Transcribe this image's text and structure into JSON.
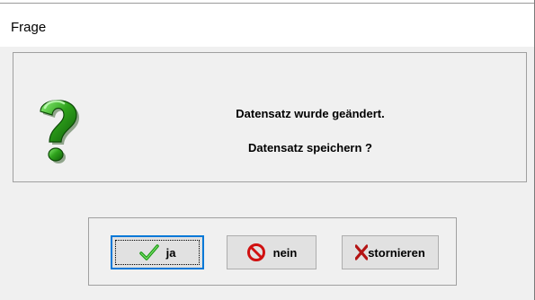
{
  "window": {
    "title": "Frage"
  },
  "message": {
    "line1": "Datensatz wurde geändert.",
    "line2": "Datensatz speichern ?",
    "icon": "question-icon"
  },
  "buttons": {
    "ja": {
      "label": "ja",
      "icon": "checkmark-icon"
    },
    "nein": {
      "label": "nein",
      "icon": "no-entry-icon"
    },
    "stornieren": {
      "label": "stornieren",
      "icon": "x-icon"
    }
  },
  "colors": {
    "question_green": "#2fa31c",
    "check_green": "#1a9a14",
    "no_red": "#d01010",
    "x_red": "#b41414",
    "focus_blue": "#0078d7"
  }
}
